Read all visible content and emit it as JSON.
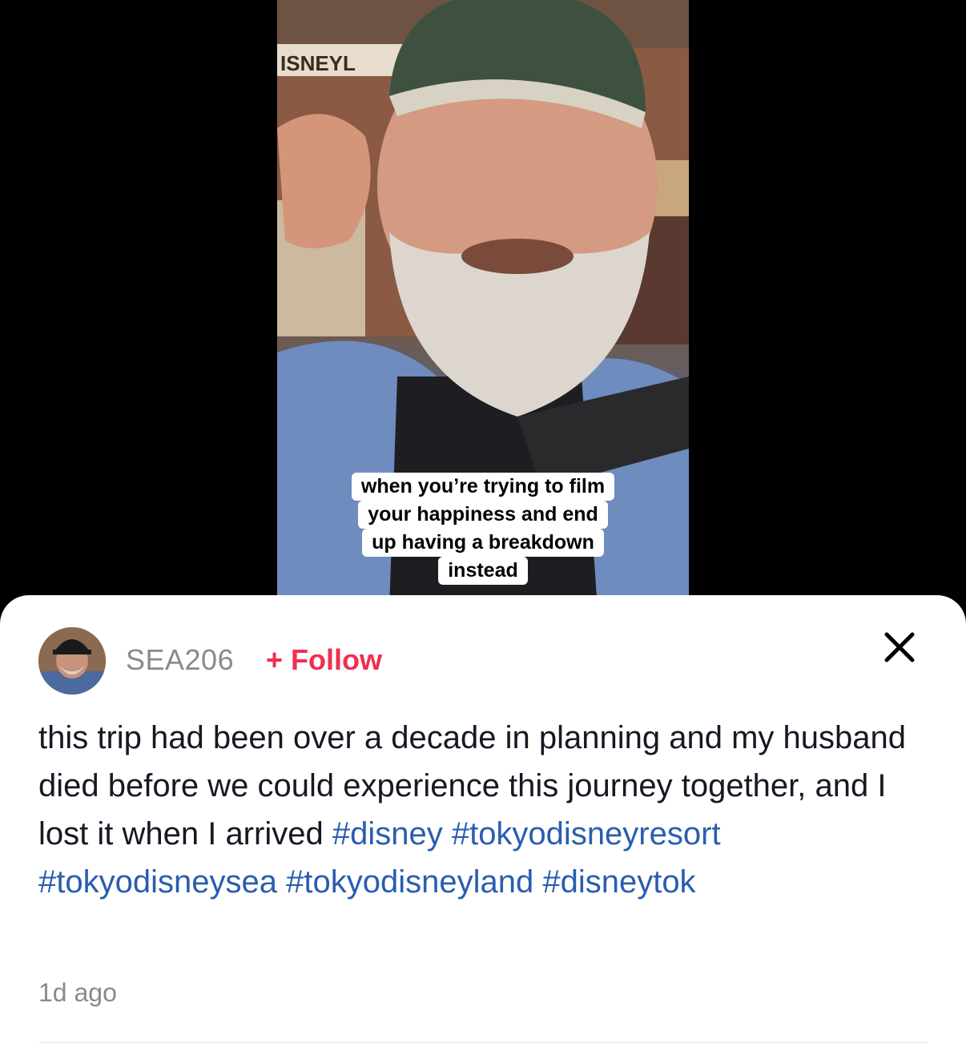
{
  "video": {
    "sign_text": "ISNEYL",
    "caption_lines": [
      "when you’re trying to film",
      "your happiness and end",
      "up having a breakdown",
      "instead"
    ]
  },
  "post": {
    "username": "SEA206",
    "follow_label": "+ Follow",
    "description_text": "this trip had been over a decade in planning and my husband died before we could experience this journey together, and I lost it when I arrived",
    "hashtags": [
      "#disney",
      "#tokyodisneyresort",
      "#tokyodisneysea",
      "#tokyodisneyland",
      "#disneytok"
    ],
    "timestamp": "1d ago",
    "close_icon": "close-icon"
  },
  "colors": {
    "follow": "#f0304e",
    "hashtag": "#2a5db0",
    "muted": "#8a8a8a"
  }
}
